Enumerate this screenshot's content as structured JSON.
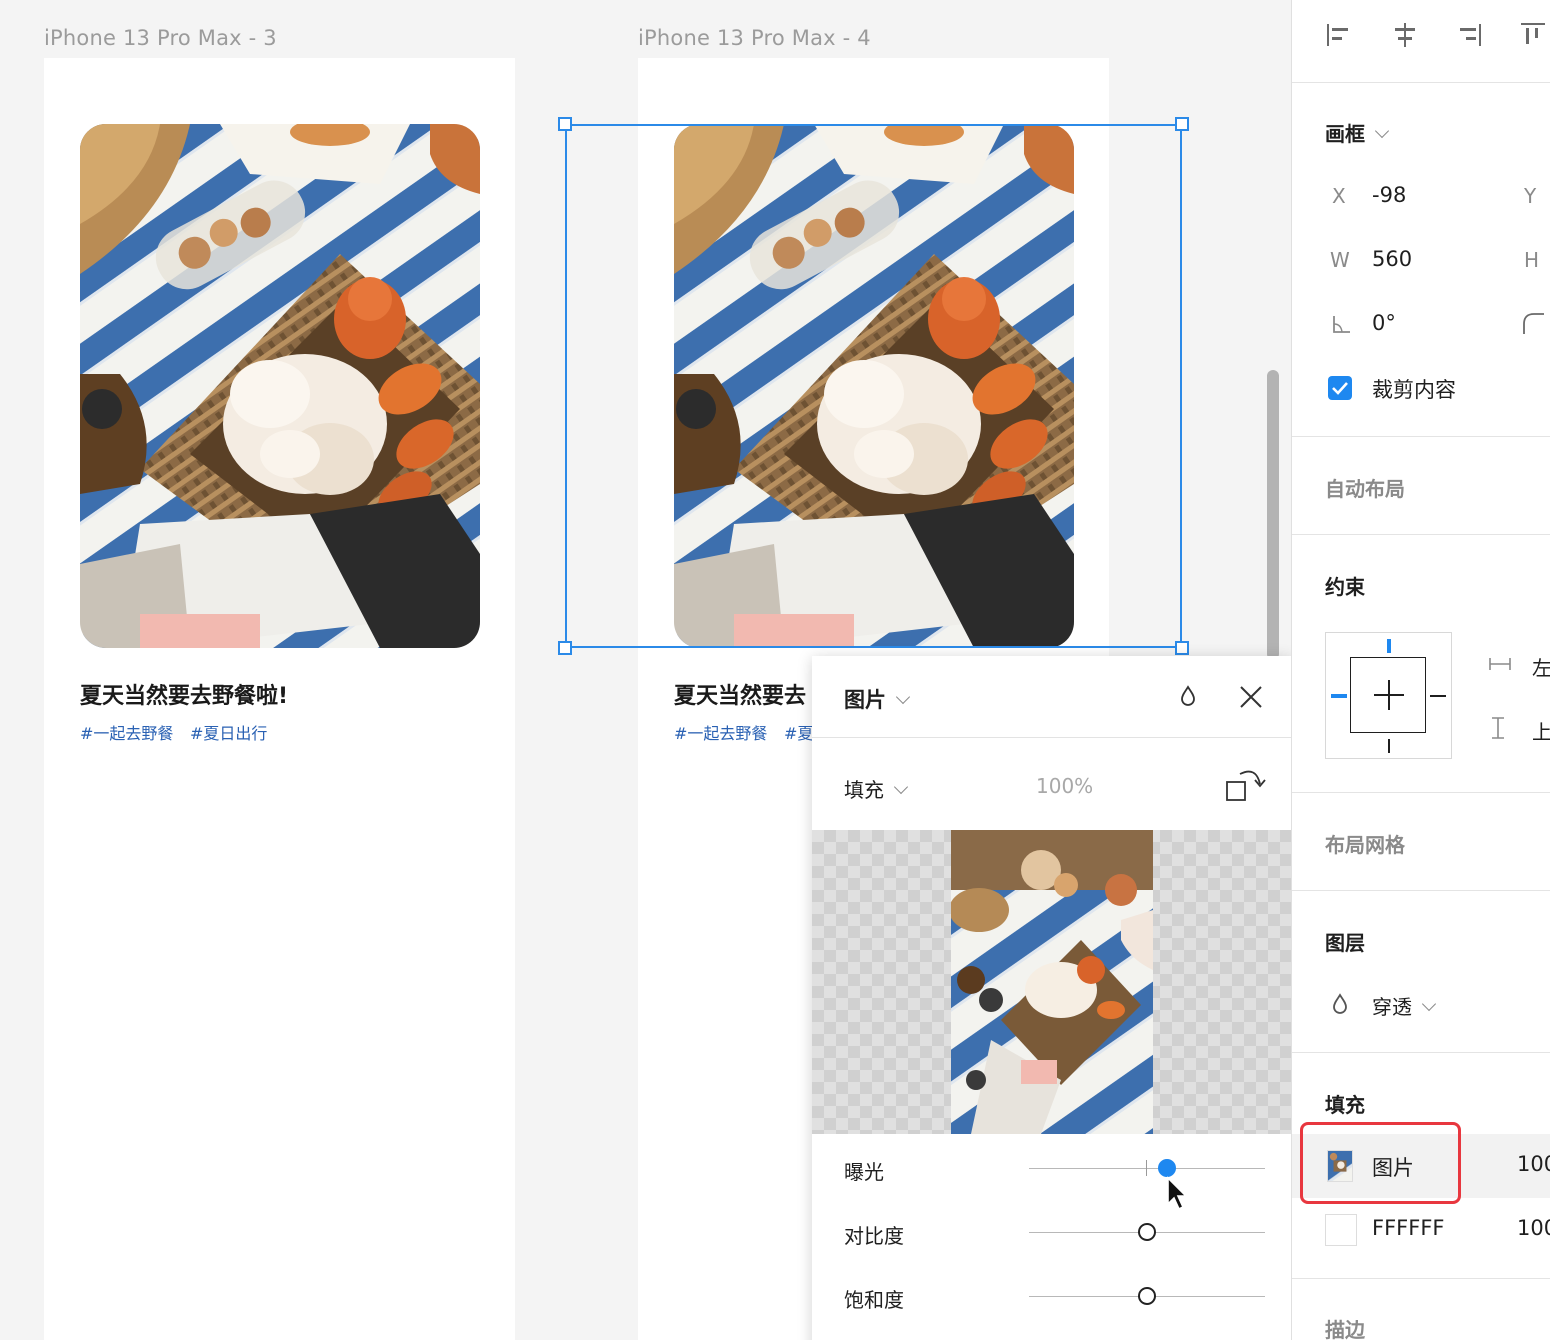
{
  "canvas": {
    "frames": [
      {
        "title": "iPhone 13 Pro Max - 3",
        "card_title": "夏天当然要去野餐啦!",
        "tags": [
          "#一起去野餐",
          "#夏日出行"
        ]
      },
      {
        "title": "iPhone 13 Pro Max - 4",
        "card_title": "夏天当然要去",
        "tags": [
          "#一起去野餐",
          "#夏"
        ]
      }
    ]
  },
  "fill_popup": {
    "title": "图片",
    "fill_label": "填充",
    "opacity": "100%",
    "adjustments": [
      {
        "label": "曝光",
        "value": 0.59,
        "active": true
      },
      {
        "label": "对比度",
        "value": 0.5,
        "active": false
      },
      {
        "label": "饱和度",
        "value": 0.5,
        "active": false
      }
    ]
  },
  "panel": {
    "frame": {
      "title": "画框",
      "x_label": "X",
      "x_value": "-98",
      "y_label": "Y",
      "w_label": "W",
      "w_value": "560",
      "h_label": "H",
      "rotation_value": "0°",
      "clip_label": "裁剪内容",
      "clip_checked": true
    },
    "auto_layout": {
      "title": "自动布局"
    },
    "constraints": {
      "title": "约束",
      "horizontal": "左",
      "vertical": "上"
    },
    "layout_grid": {
      "title": "布局网格"
    },
    "layer": {
      "title": "图层",
      "blend_mode": "穿透"
    },
    "fill": {
      "title": "填充",
      "items": [
        {
          "label": "图片",
          "opacity": "100"
        },
        {
          "label": "FFFFFF",
          "opacity": "100"
        }
      ]
    },
    "stroke": {
      "title": "描边"
    }
  },
  "colors": {
    "accent": "#1e88f0",
    "selection": "#2b8ae8",
    "highlight": "#e8373f",
    "tag": "#2a61b3"
  }
}
